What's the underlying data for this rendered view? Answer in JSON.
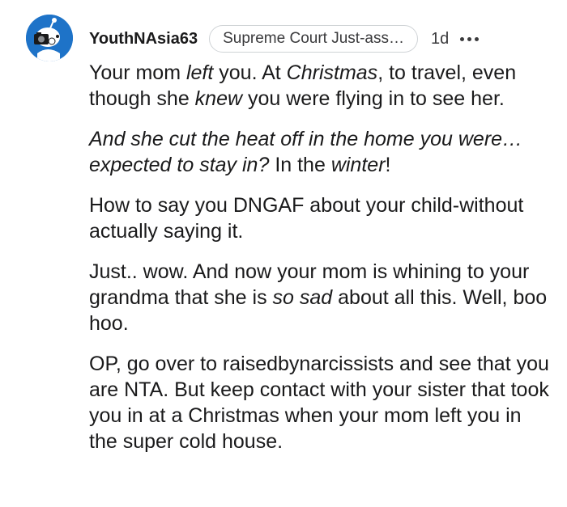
{
  "comment": {
    "username": "YouthNAsia63",
    "flair": "Supreme Court Just-ass…",
    "age": "1d",
    "more_icon": "more-horizontal-icon",
    "avatar_icon": "snoo-avatar-icon",
    "colors": {
      "avatar_bg": "#1e73c8",
      "text": "#1a1a1b",
      "flair_border": "#cfd3d6"
    },
    "p1": {
      "a": "Your mom ",
      "b": "left",
      "c": " you. At ",
      "d": "Christmas",
      "e": ", to travel, even though she ",
      "f": "knew",
      "g": " you were flying in to see her."
    },
    "p2": {
      "a": "And she cut the heat off in the home you were… expected to stay in?",
      "b": " In the ",
      "c": "winter",
      "d": "!"
    },
    "p3": "How to say you DNGAF about your child-without actually saying it.",
    "p4": {
      "a": "Just.. wow. And now your mom is whining to your grandma that she is ",
      "b": "so sad",
      "c": " about all this. Well, boo hoo."
    },
    "p5": "OP, go over to raisedbynarcissists and see that you are NTA. But keep contact with your sister that took you in at a Christmas when your mom left you in the super cold house."
  }
}
